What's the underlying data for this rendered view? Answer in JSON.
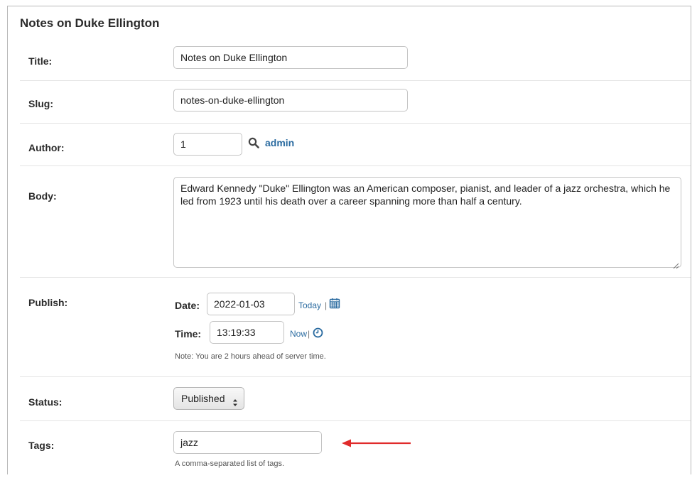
{
  "form": {
    "heading": "Notes on Duke Ellington",
    "title": {
      "label": "Title:",
      "value": "Notes on Duke Ellington"
    },
    "slug": {
      "label": "Slug:",
      "value": "notes-on-duke-ellington"
    },
    "author": {
      "label": "Author:",
      "value": "1",
      "lookup_text": "admin",
      "lookup_icon": "search-icon"
    },
    "body": {
      "label": "Body:",
      "value": "Edward Kennedy \"Duke\" Ellington was an American composer, pianist, and leader of a jazz orchestra, which he led from 1923 until his death over a career spanning more than half a century."
    },
    "publish": {
      "label": "Publish:",
      "date_label": "Date:",
      "date_value": "2022-01-03",
      "today_link": "Today",
      "separator": "|",
      "calendar_icon": "calendar-icon",
      "time_label": "Time:",
      "time_value": "13:19:33",
      "now_link": "Now",
      "clock_icon": "clock-icon",
      "note": "Note: You are 2 hours ahead of server time."
    },
    "status": {
      "label": "Status:",
      "selected": "Published"
    },
    "tags": {
      "label": "Tags:",
      "value": "jazz",
      "help": "A comma-separated list of tags."
    }
  },
  "colors": {
    "link": "#2a6ba0",
    "arrow": "#e02b2b"
  }
}
